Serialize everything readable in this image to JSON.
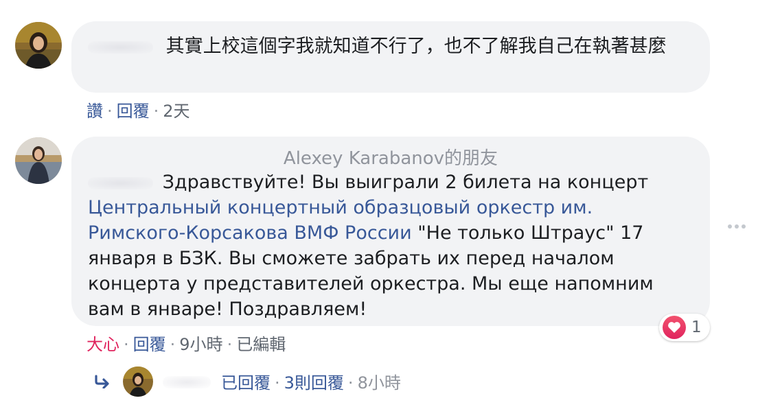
{
  "comment1": {
    "text": "其實上校這個字我就知道不行了，也不了解我自己在執著甚麼",
    "actions": {
      "like": "讚",
      "reply": "回覆",
      "time": "2天"
    }
  },
  "comment2": {
    "friend_label": "Alexey Karabanov的朋友",
    "text_intro": "Здравствуйте! Вы выиграли 2 билета на концерт",
    "link_text": "Центральный концертный образцовый оркестр им. Римского-Корсакова ВМФ России",
    "text_rest": " \"Не только Штраус\" 17 января в БЗК. Вы сможете забрать их перед началом концерта у представителей оркестра. Мы еще напомним вам в январе! Поздравляем!",
    "actions": {
      "reaction": "大心",
      "reply": "回覆",
      "time": "9小時",
      "edited": "已編輯"
    },
    "reaction_count": "1"
  },
  "reply_summary": {
    "replied": "已回覆",
    "count": "3則回覆",
    "time": "8小時"
  },
  "colors": {
    "link": "#385898",
    "bubble": "#f2f3f5",
    "heart": "#e0245e",
    "meta": "#606770"
  }
}
